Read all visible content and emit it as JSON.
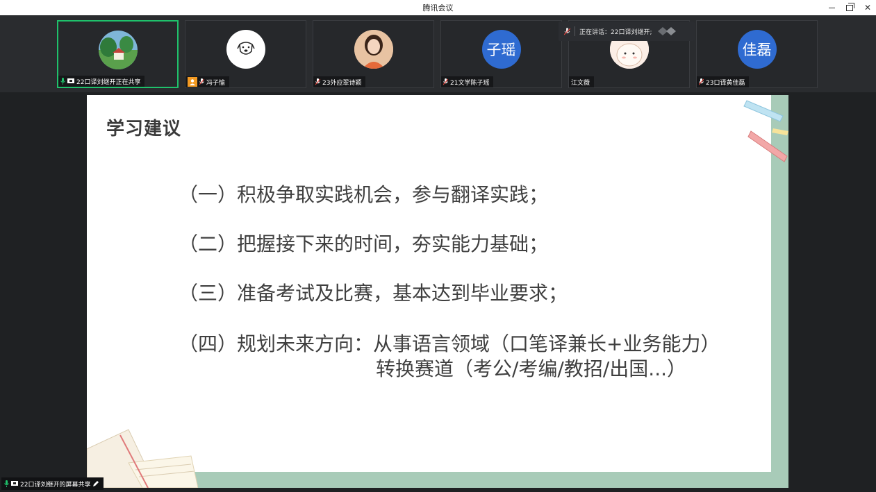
{
  "window": {
    "title": "腾讯会议"
  },
  "gallery": {
    "participants": [
      {
        "name": "22口译刘继开正在共享",
        "avatar_type": "photo-landscape"
      },
      {
        "name": "冯子愉",
        "avatar_type": "drawing-dog"
      },
      {
        "name": "23外应翠诗颖",
        "avatar_type": "photo-person"
      },
      {
        "name": "21文学陈子瑶",
        "avatar_text": "子瑶",
        "avatar_color": "#2f6bd1"
      },
      {
        "name": "江文薇",
        "avatar_type": "drawing-bear"
      },
      {
        "name": "23口译黄佳磊",
        "avatar_text": "佳磊",
        "avatar_color": "#2f6bd1"
      }
    ],
    "speaking_indicator": "正在讲话：22口译刘继开;"
  },
  "slide": {
    "title": "学习建议",
    "points": [
      "（一）积极争取实践机会，参与翻译实践；",
      "（二）把握接下来的时间，夯实能力基础；",
      "（三）准备考试及比赛，基本达到毕业要求；",
      "（四）规划未来方向：从事语言领域（口笔译兼长+业务能力）"
    ],
    "point4_line2": "转换赛道（考公/考编/教招/出国...）"
  },
  "share_bar": {
    "label": "22口译刘继开的屏幕共享"
  },
  "colors": {
    "active_border": "#1fc16b",
    "mic_green": "#1fc16b",
    "slide_border": "#a8cbb8"
  }
}
